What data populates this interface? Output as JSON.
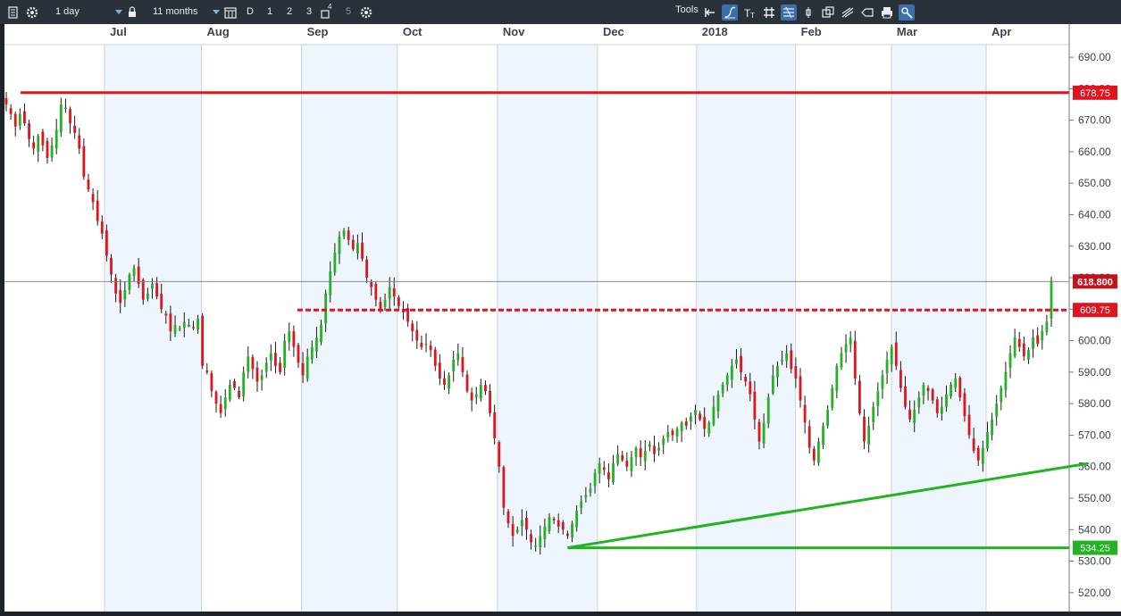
{
  "toolbar": {
    "interval": "1 day",
    "range": "11 months",
    "timeframes": [
      "D",
      "1",
      "2",
      "3",
      "4",
      "5"
    ],
    "tools_label": "Tools"
  },
  "colors": {
    "up": "#22b322",
    "down": "#e0141e",
    "resistance": "#e0141e",
    "support": "#22b322",
    "shade": "#eef5fc"
  },
  "chart_data": {
    "type": "candlestick",
    "ylim": [
      514,
      694
    ],
    "y_ticks": [
      "690.00",
      "680.00",
      "670.00",
      "660.00",
      "650.00",
      "640.00",
      "630.00",
      "620.00",
      "610.00",
      "600.00",
      "590.00",
      "580.00",
      "570.00",
      "560.00",
      "550.00",
      "540.00",
      "530.00",
      "520.00"
    ],
    "x_labels": [
      "Jul",
      "Aug",
      "Sep",
      "Oct",
      "Nov",
      "Dec",
      "2018",
      "Feb",
      "Mar",
      "Apr"
    ],
    "current_price": "618.800",
    "levels": [
      {
        "label": "678.75",
        "value": 678.75,
        "style": "solid",
        "color": "red"
      },
      {
        "label": "609.75",
        "value": 609.75,
        "style": "dashed",
        "color": "red"
      },
      {
        "label": "534.25",
        "value": 534.25,
        "style": "solid",
        "color": "green"
      }
    ],
    "trendline": {
      "from": {
        "index": 123,
        "value": 534.25
      },
      "to": {
        "index": 237,
        "value": 561.0
      }
    },
    "closes": [
      675,
      672,
      668,
      672,
      669,
      664,
      661,
      665,
      662,
      658,
      662,
      667,
      675,
      674,
      669,
      666,
      661,
      652,
      648,
      644,
      638,
      634,
      627,
      621,
      615,
      612,
      616,
      621,
      623,
      618,
      613,
      615,
      618,
      614,
      610,
      608,
      603,
      605,
      604,
      606,
      605,
      604,
      607,
      592,
      590,
      584,
      580,
      577,
      582,
      586,
      585,
      582,
      590,
      595,
      591,
      587,
      589,
      593,
      596,
      592,
      590,
      600,
      603,
      598,
      593,
      589,
      595,
      598,
      601,
      605,
      615,
      622,
      628,
      633,
      635,
      632,
      629,
      631,
      626,
      620,
      617,
      613,
      610,
      613,
      617,
      614,
      611,
      609,
      606,
      603,
      600,
      598,
      599,
      597,
      592,
      588,
      586,
      589,
      594,
      596,
      590,
      584,
      581,
      583,
      586,
      584,
      577,
      569,
      560,
      547,
      542,
      538,
      540,
      543,
      540,
      536,
      535,
      538,
      541,
      544,
      543,
      541,
      540,
      538,
      542,
      546,
      549,
      551,
      553,
      558,
      561,
      559,
      556,
      561,
      564,
      562,
      560,
      563,
      566,
      563,
      565,
      567,
      564,
      566,
      569,
      571,
      570,
      572,
      574,
      573,
      576,
      578,
      575,
      572,
      574,
      579,
      583,
      586,
      589,
      592,
      594,
      590,
      587,
      583,
      575,
      568,
      574,
      582,
      589,
      592,
      594,
      596,
      591,
      588,
      581,
      574,
      566,
      562,
      568,
      573,
      578,
      585,
      592,
      596,
      599,
      601,
      588,
      577,
      568,
      573,
      579,
      584,
      589,
      594,
      598,
      592,
      585,
      579,
      575,
      578,
      582,
      586,
      584,
      581,
      577,
      579,
      583,
      586,
      588,
      582,
      576,
      570,
      565,
      562,
      566,
      571,
      575,
      580,
      585,
      590,
      596,
      601,
      598,
      595,
      597,
      601,
      599,
      603,
      606,
      619
    ]
  }
}
